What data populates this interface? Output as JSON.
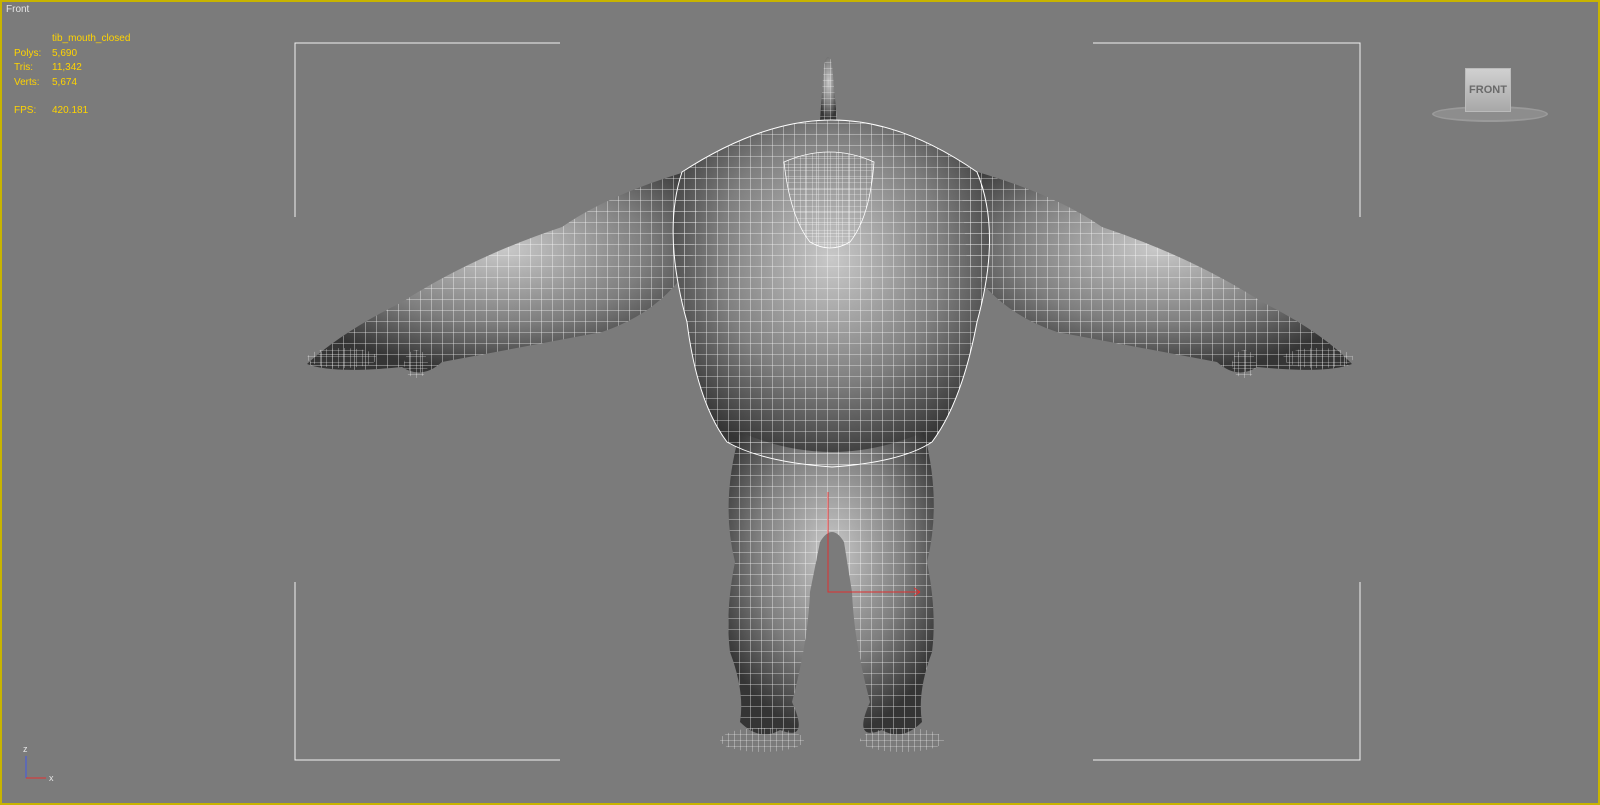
{
  "viewport": {
    "label": "Front",
    "border_color": "#c8b400",
    "background": "#7b7b7b"
  },
  "stats": {
    "object_name": "tib_mouth_closed",
    "polys_label": "Polys:",
    "polys_value": "5,690",
    "tris_label": "Tris:",
    "tris_value": "11,342",
    "verts_label": "Verts:",
    "verts_value": "5,674",
    "fps_label": "FPS:",
    "fps_value": "420.181",
    "text_color": "#ffd400"
  },
  "viewcube": {
    "face_label": "FRONT"
  },
  "axis_gizmo": {
    "z_label": "z",
    "x_label": "x"
  },
  "icons": {
    "viewcube": "viewcube-icon",
    "axis": "axis-tripod-icon"
  }
}
